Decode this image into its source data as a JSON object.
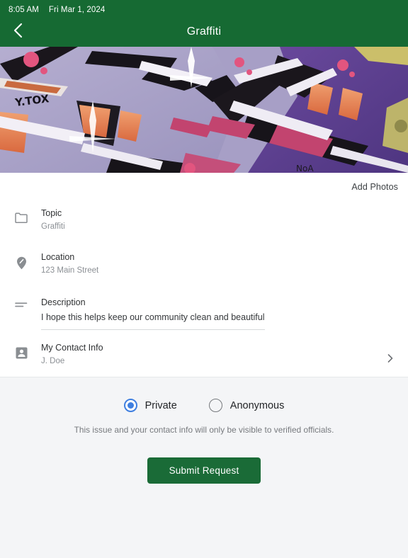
{
  "status_bar": {
    "time": "8:05 AM",
    "date": "Fri Mar 1, 2024"
  },
  "nav": {
    "back_icon": "chevron-left-icon",
    "title": "Graffiti"
  },
  "photo": {
    "alt": "graffiti-mural-photo",
    "tag_text": "Y.TOX"
  },
  "photos_action": {
    "label": "Add Photos"
  },
  "fields": [
    {
      "icon": "folder-icon",
      "label": "Topic",
      "value": "Graffiti"
    },
    {
      "icon": "map-pin-icon",
      "label": "Location",
      "value": "123 Main Street"
    },
    {
      "icon": "description-lines-icon",
      "label": "Description",
      "value": "I hope this helps keep our community clean and beautiful"
    },
    {
      "icon": "account-box-icon",
      "label": "My Contact Info",
      "value": "J. Doe",
      "chevron": "chevron-right-icon"
    }
  ],
  "visibility": {
    "options": [
      {
        "label": "Private",
        "selected": true
      },
      {
        "label": "Anonymous",
        "selected": false
      }
    ],
    "note": "This issue and your contact info will only be visible to verified officials."
  },
  "submit": {
    "label": "Submit Request"
  },
  "colors": {
    "header_green": "#166a33",
    "button_green": "#1a6b37",
    "radio_blue": "#3f7fe0",
    "panel_gray": "#f4f5f7"
  }
}
